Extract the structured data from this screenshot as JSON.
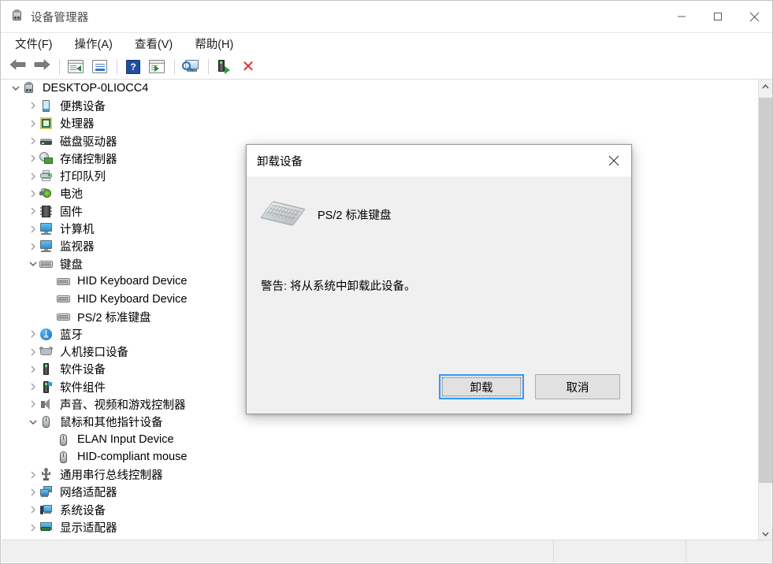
{
  "window": {
    "title": "设备管理器",
    "title_icon": "device-manager-icon",
    "minimize_label": "—",
    "maximize_label": "□",
    "close_label": "✕"
  },
  "menubar": {
    "items": [
      {
        "label": "文件(F)",
        "name": "menu-file"
      },
      {
        "label": "操作(A)",
        "name": "menu-action"
      },
      {
        "label": "查看(V)",
        "name": "menu-view"
      },
      {
        "label": "帮助(H)",
        "name": "menu-help"
      }
    ]
  },
  "toolbar": {
    "items": [
      {
        "name": "back-button",
        "icon": "back-arrow-icon",
        "type": "arrow-back"
      },
      {
        "name": "forward-button",
        "icon": "forward-arrow-icon",
        "type": "arrow-forward"
      },
      {
        "name": "show-hide-console-tree-button",
        "icon": "console-tree-icon",
        "type": "window"
      },
      {
        "name": "properties-button",
        "icon": "properties-icon",
        "type": "props"
      },
      {
        "name": "help-button",
        "icon": "help-question-icon",
        "type": "help",
        "glyph": "?"
      },
      {
        "name": "show-pane-button",
        "icon": "pane-icon",
        "type": "window2"
      },
      {
        "name": "scan-hardware-changes-button",
        "icon": "scan-magnifier-icon",
        "type": "scan"
      },
      {
        "name": "update-driver-button",
        "icon": "update-driver-icon",
        "type": "uninstall"
      },
      {
        "name": "uninstall-device-button",
        "icon": "red-x-icon",
        "type": "redx",
        "glyph": "✕"
      }
    ]
  },
  "tree": {
    "root": {
      "label": "DESKTOP-0LIOCC4",
      "icon": "computer-root-icon",
      "expanded": true,
      "depth": 0
    },
    "nodes": [
      {
        "label": "便携设备",
        "icon": "portable-device-icon",
        "depth": 1,
        "expanded": false,
        "has_children": true
      },
      {
        "label": "处理器",
        "icon": "processor-icon",
        "depth": 1,
        "expanded": false,
        "has_children": true
      },
      {
        "label": "磁盘驱动器",
        "icon": "disk-drive-icon",
        "depth": 1,
        "expanded": false,
        "has_children": true
      },
      {
        "label": "存储控制器",
        "icon": "storage-controller-icon",
        "depth": 1,
        "expanded": false,
        "has_children": true
      },
      {
        "label": "打印队列",
        "icon": "print-queue-icon",
        "depth": 1,
        "expanded": false,
        "has_children": true
      },
      {
        "label": "电池",
        "icon": "battery-icon",
        "depth": 1,
        "expanded": false,
        "has_children": true
      },
      {
        "label": "固件",
        "icon": "firmware-icon",
        "depth": 1,
        "expanded": false,
        "has_children": true
      },
      {
        "label": "计算机",
        "icon": "computer-icon",
        "depth": 1,
        "expanded": false,
        "has_children": true
      },
      {
        "label": "监视器",
        "icon": "monitor-icon",
        "depth": 1,
        "expanded": false,
        "has_children": true
      },
      {
        "label": "键盘",
        "icon": "keyboard-icon",
        "depth": 1,
        "expanded": true,
        "has_children": true
      },
      {
        "label": "HID Keyboard Device",
        "icon": "keyboard-icon",
        "depth": 2,
        "has_children": false
      },
      {
        "label": "HID Keyboard Device",
        "icon": "keyboard-icon",
        "depth": 2,
        "has_children": false
      },
      {
        "label": "PS/2 标准键盘",
        "icon": "keyboard-icon",
        "depth": 2,
        "has_children": false
      },
      {
        "label": "蓝牙",
        "icon": "bluetooth-icon",
        "depth": 1,
        "expanded": false,
        "has_children": true
      },
      {
        "label": "人机接口设备",
        "icon": "hid-device-icon",
        "depth": 1,
        "expanded": false,
        "has_children": true
      },
      {
        "label": "软件设备",
        "icon": "software-device-icon",
        "depth": 1,
        "expanded": false,
        "has_children": true
      },
      {
        "label": "软件组件",
        "icon": "software-component-icon",
        "depth": 1,
        "expanded": false,
        "has_children": true
      },
      {
        "label": "声音、视频和游戏控制器",
        "icon": "sound-video-game-icon",
        "depth": 1,
        "expanded": false,
        "has_children": true
      },
      {
        "label": "鼠标和其他指针设备",
        "icon": "mouse-icon",
        "depth": 1,
        "expanded": true,
        "has_children": true
      },
      {
        "label": "ELAN Input Device",
        "icon": "mouse-icon",
        "depth": 2,
        "has_children": false
      },
      {
        "label": "HID-compliant mouse",
        "icon": "mouse-icon",
        "depth": 2,
        "has_children": false
      },
      {
        "label": "通用串行总线控制器",
        "icon": "usb-controller-icon",
        "depth": 1,
        "expanded": false,
        "has_children": true
      },
      {
        "label": "网络适配器",
        "icon": "network-adapter-icon",
        "depth": 1,
        "expanded": false,
        "has_children": true
      },
      {
        "label": "系统设备",
        "icon": "system-device-icon",
        "depth": 1,
        "expanded": false,
        "has_children": true
      },
      {
        "label": "显示适配器",
        "icon": "display-adapter-icon",
        "depth": 1,
        "expanded": false,
        "has_children": true
      }
    ],
    "expand_glyph": "⌄",
    "collapse_glyph": "›"
  },
  "scrollbar": {
    "up_glyph": "⌃",
    "down_glyph": "⌄"
  },
  "dialog": {
    "title": "卸载设备",
    "close_label": "✕",
    "device_icon": "keyboard-perspective-icon",
    "device_name": "PS/2 标准键盘",
    "warning": "警告: 将从系统中卸载此设备。",
    "confirm_label": "卸载",
    "cancel_label": "取消"
  },
  "statusbar": {
    "segments": [
      "",
      "",
      ""
    ]
  },
  "colors": {
    "accent": "#3399ff",
    "danger": "#e03131",
    "window_bg": "#ffffff",
    "dialog_bg": "#f0f0f0",
    "scrollbar_thumb": "#cdcdcd"
  }
}
